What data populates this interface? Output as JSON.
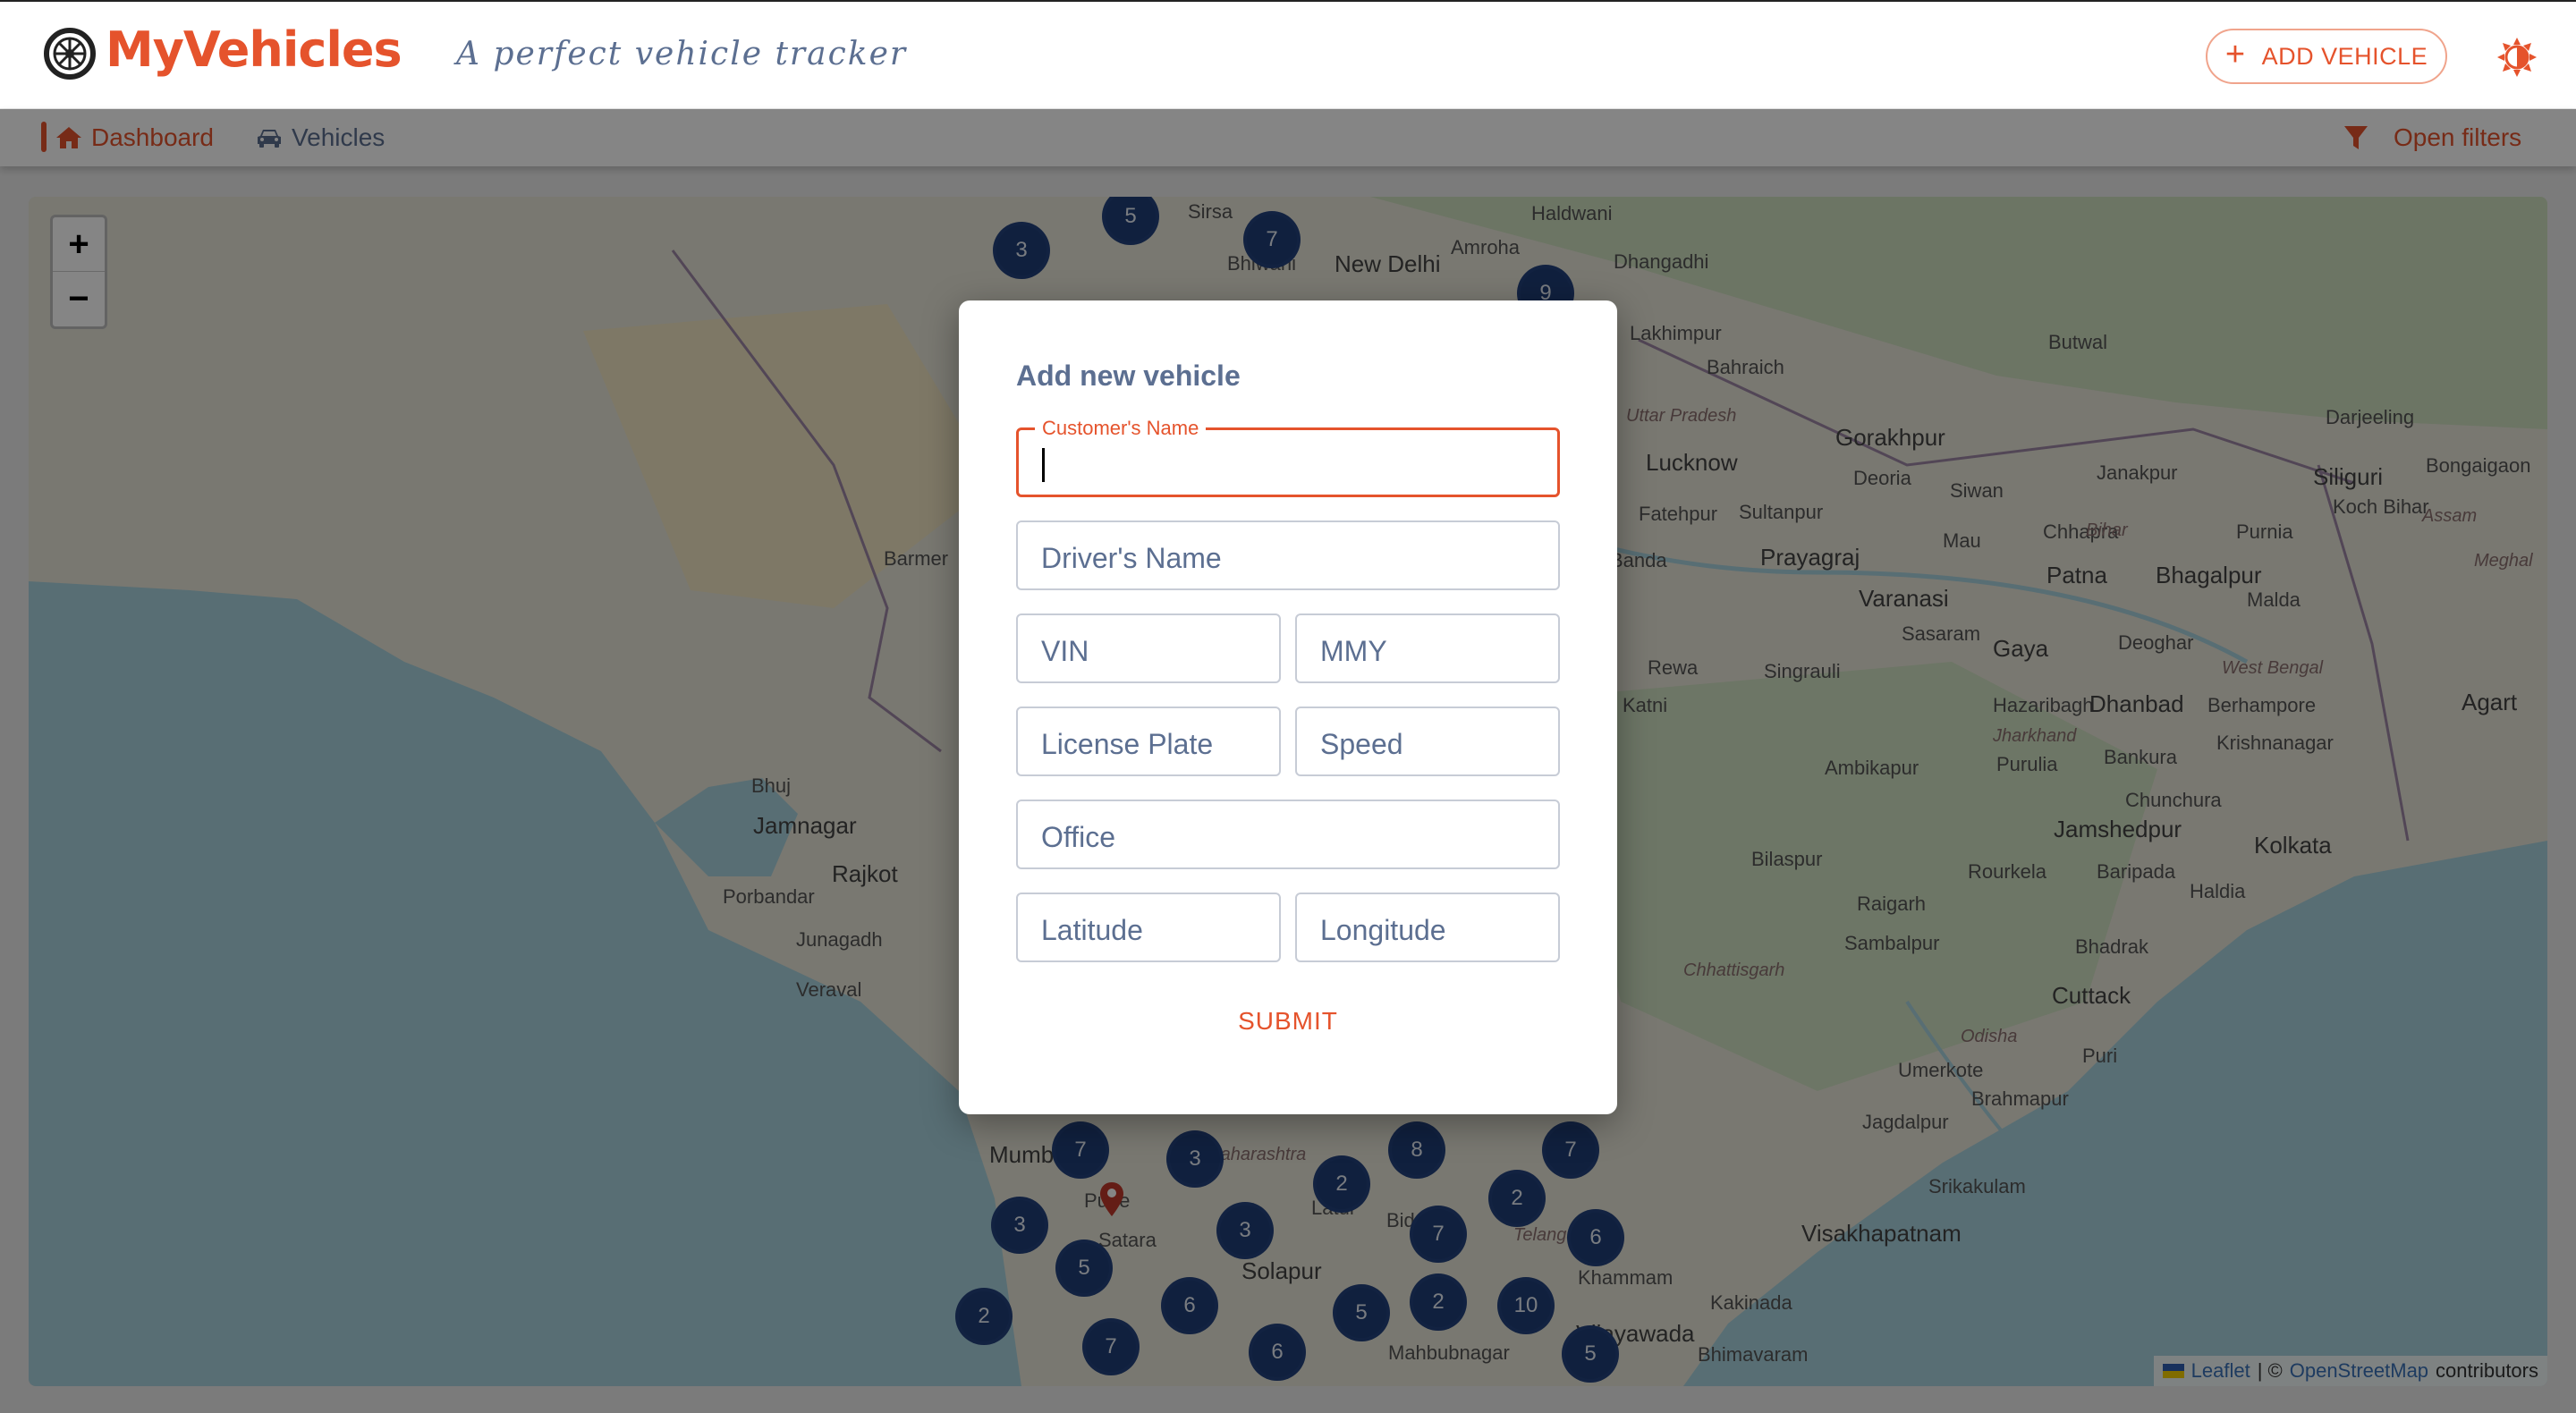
{
  "app": {
    "title": "MyVehicles",
    "tagline": "A perfect vehicle tracker",
    "add_vehicle_label": "ADD VEHICLE",
    "theme_icon": "sun-icon",
    "brand_icon": "wheel-icon",
    "accent_color": "#e5532c",
    "muted_color": "#5c6f91"
  },
  "nav": {
    "dashboard_label": "Dashboard",
    "vehicles_label": "Vehicles",
    "filters_label": "Open filters",
    "dashboard_icon": "home-icon",
    "vehicles_icon": "car-icon",
    "filters_icon": "funnel-icon"
  },
  "map": {
    "zoom_in": "+",
    "zoom_out": "−",
    "attribution": {
      "leaflet": "Leaflet",
      "sep": "| ©",
      "osm": "OpenStreetMap",
      "contributors": "contributors"
    },
    "place_labels": [
      "Sirsa",
      "Bhiwani",
      "New Delhi",
      "Amroha",
      "Haldwani",
      "Dhangadhi",
      "Lakhimpur",
      "Bahraich",
      "Lucknow",
      "Gorakhpur",
      "Deoria",
      "Siwan",
      "Fatehpur",
      "Sultanpur",
      "Prayagraj",
      "Varanasi",
      "Mau",
      "Chhapra",
      "Patna",
      "Bhagalpur",
      "Janakpur",
      "Siliguri",
      "Darjeeling",
      "Koch Bihar",
      "Bongaigaon",
      "Purnia",
      "Malda",
      "Sasaram",
      "Gaya",
      "Deoghar",
      "Rewa",
      "Singrauli",
      "Katni",
      "Hazaribagh",
      "Dhanbad",
      "Berhampore",
      "Krishnanagar",
      "Agart",
      "Ambikapur",
      "Purulia",
      "Bankura",
      "Chunchura",
      "Kolkata",
      "Jamshedpur",
      "Rourkela",
      "Baripada",
      "Haldia",
      "Bilaspur",
      "Raigarh",
      "Sambalpur",
      "Bhadrak",
      "Cuttack",
      "Puri",
      "Umerkote",
      "Jagdalpur",
      "Brahmapur",
      "Srikakulam",
      "Visakhapatnam",
      "Kakinada",
      "Bhimavaram",
      "Khammam",
      "Vijayawada",
      "Mahbubnagar",
      "Solapur",
      "Satara",
      "Mumbai",
      "Bhuj",
      "Jamnagar",
      "Rajkot",
      "Porbandar",
      "Junagadh",
      "Veraval",
      "Barmer",
      "Butwal",
      "Uttar Pradesh",
      "Jharkhand",
      "West Bengal",
      "Bihar",
      "Chhattisgarh",
      "Odisha",
      "Assam",
      "Meghal",
      "Telangana",
      "Maharashtra",
      "Banda",
      "Pune",
      "Latur",
      "Bidar"
    ],
    "clusters": [
      "3",
      "5",
      "7",
      "7",
      "3",
      "9",
      "7",
      "3",
      "2",
      "2",
      "8",
      "2",
      "3",
      "3",
      "7",
      "2",
      "6",
      "5",
      "6",
      "2",
      "10",
      "5",
      "7",
      "6",
      "5",
      "2",
      "7"
    ]
  },
  "dialog": {
    "title": "Add new vehicle",
    "customer_label": "Customer's Name",
    "customer_value": "",
    "driver_placeholder": "Driver's Name",
    "vin_placeholder": "VIN",
    "mmy_placeholder": "MMY",
    "plate_placeholder": "License Plate",
    "speed_placeholder": "Speed",
    "office_placeholder": "Office",
    "lat_placeholder": "Latitude",
    "lng_placeholder": "Longitude",
    "submit_label": "SUBMIT"
  }
}
